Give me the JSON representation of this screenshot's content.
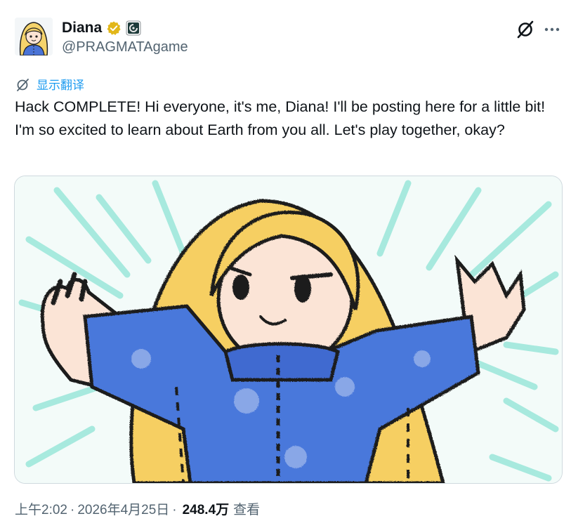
{
  "author": {
    "display_name": "Diana",
    "handle": "@PRAGMATAgame",
    "verified_badge_color": "#e2b719",
    "affiliate_badge_color": "#1e3b3a"
  },
  "actions": {
    "grok_icon": "grok-slash-icon",
    "more_icon": "more-dots-icon"
  },
  "translate": {
    "label": "显示翻译",
    "icon": "translate-globe-icon",
    "color": "#1d9bf0"
  },
  "tweet": {
    "text": "Hack COMPLETE! Hi everyone, it's me, Diana! I'll be posting here for a little bit! I'm so excited to learn about Earth from you all. Let's play together, okay?"
  },
  "media": {
    "description_icon": "crayon-drawing-image"
  },
  "meta": {
    "time": "上午2:02",
    "separator": "·",
    "date": "2026年4月25日",
    "views_count": "248.4万",
    "views_label": "查看"
  }
}
